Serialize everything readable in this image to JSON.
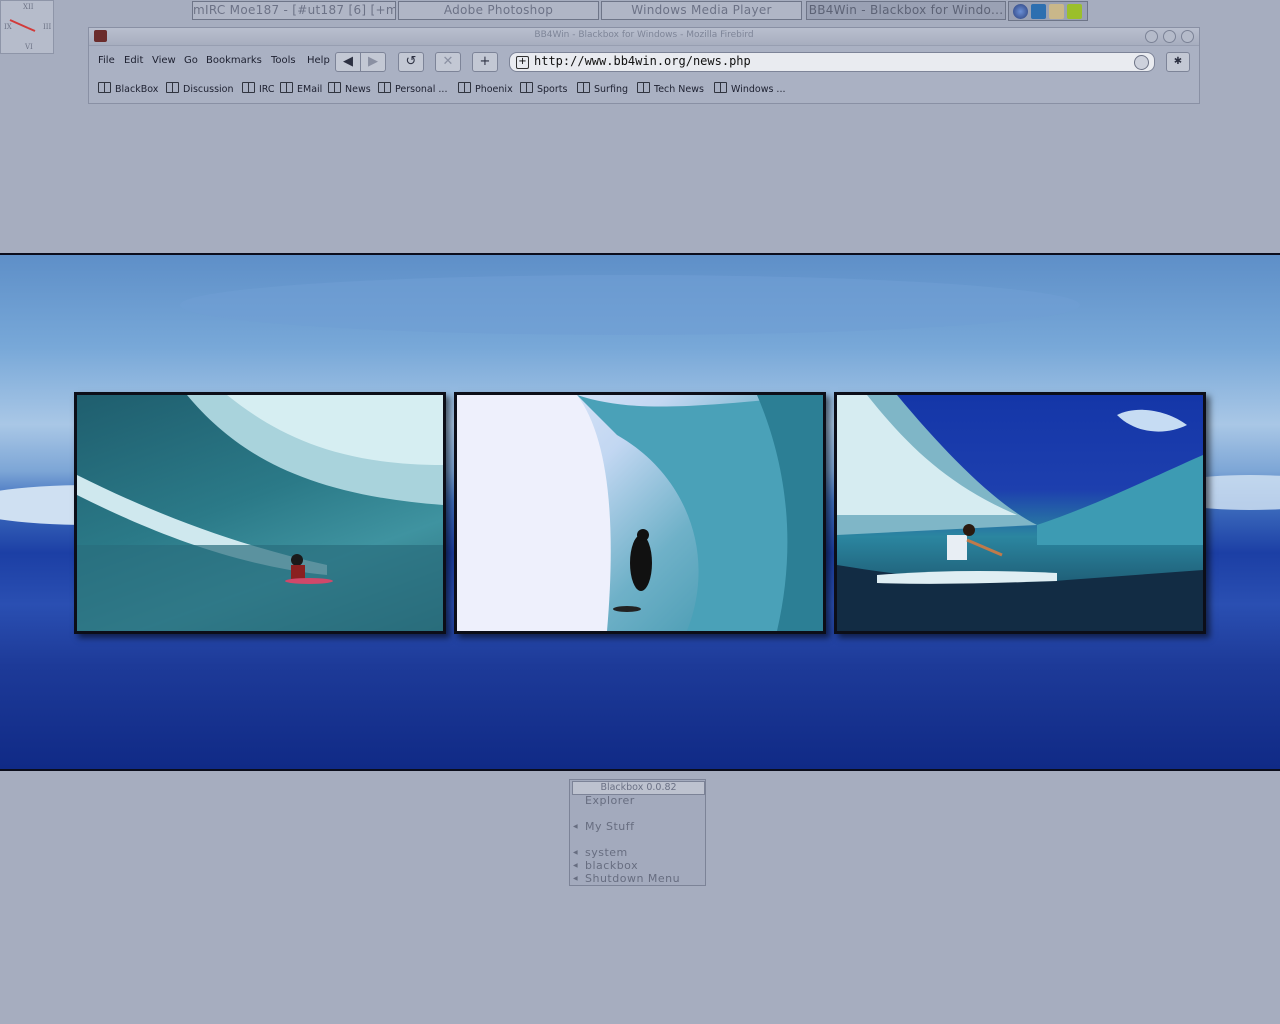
{
  "clock": {
    "numerals": [
      "XII",
      "III",
      "VI",
      "IX"
    ]
  },
  "taskbar": {
    "tasks": [
      {
        "label": "mIRC Moe187 - [#ut187 [6] [+mnt..."
      },
      {
        "label": "Adobe Photoshop"
      },
      {
        "label": "Windows Media Player"
      },
      {
        "label": "BB4Win - Blackbox for Windo..."
      }
    ],
    "tray_icons": [
      "globe-icon",
      "network-icon",
      "blackbox-icon",
      "nvidia-icon"
    ]
  },
  "browser": {
    "title": "BB4Win - Blackbox for Windows - Mozilla Firebird",
    "menu": [
      "File",
      "Edit",
      "View",
      "Go",
      "Bookmarks",
      "Tools",
      "Help"
    ],
    "nav": {
      "back": "◀",
      "forward": "▶",
      "reload": "↺",
      "stop": "✕",
      "new_tab": "+"
    },
    "url": "http://www.bb4win.org/news.php",
    "bookmarks": [
      "BlackBox",
      "Discussion",
      "IRC",
      "EMail",
      "News",
      "Personal ...",
      "Phoenix",
      "Sports",
      "Surfing",
      "Tech News",
      "Windows ..."
    ]
  },
  "wallpaper": {
    "photos": [
      "surfer-left",
      "surfer-center",
      "surfer-right"
    ]
  },
  "blackbox_menu": {
    "title": "Blackbox 0.0.82",
    "items": [
      {
        "label": "Explorer",
        "submenu": false
      },
      {
        "label": "My Stuff",
        "submenu": true
      },
      {
        "label": "system",
        "submenu": true
      },
      {
        "label": "blackbox",
        "submenu": true
      },
      {
        "label": "Shutdown Menu",
        "submenu": true
      }
    ]
  },
  "colors": {
    "desktop": "#a6adbf",
    "ocean_deep": "#102a86",
    "sky": "#78a8d8"
  }
}
